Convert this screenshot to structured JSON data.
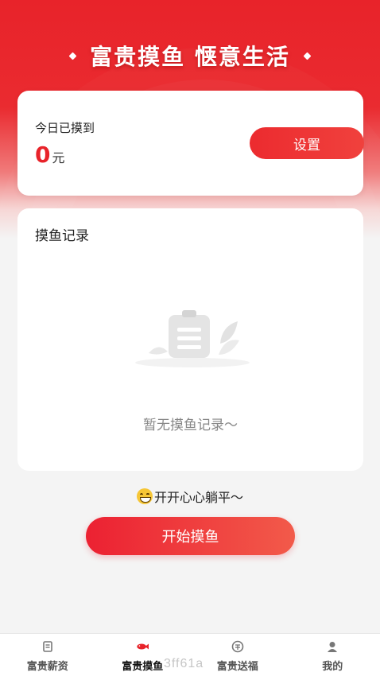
{
  "banner": {
    "title": "富贵摸鱼 惬意生活"
  },
  "today": {
    "label": "今日已摸到",
    "amount": "0",
    "unit": "元",
    "settings_label": "设置"
  },
  "records": {
    "heading": "摸鱼记录",
    "empty_text": "暂无摸鱼记录～"
  },
  "tagline": "开开心心躺平～",
  "start_button": "开始摸鱼",
  "tabs": [
    {
      "label": "富贵薪资",
      "icon": "document-icon"
    },
    {
      "label": "富贵摸鱼",
      "icon": "fish-icon",
      "active": true
    },
    {
      "label": "富贵送福",
      "icon": "coin-icon"
    },
    {
      "label": "我的",
      "icon": "user-icon"
    }
  ],
  "watermark": "3ff61a",
  "colors": {
    "accent": "#e8232a",
    "background": "#f4f4f4"
  }
}
